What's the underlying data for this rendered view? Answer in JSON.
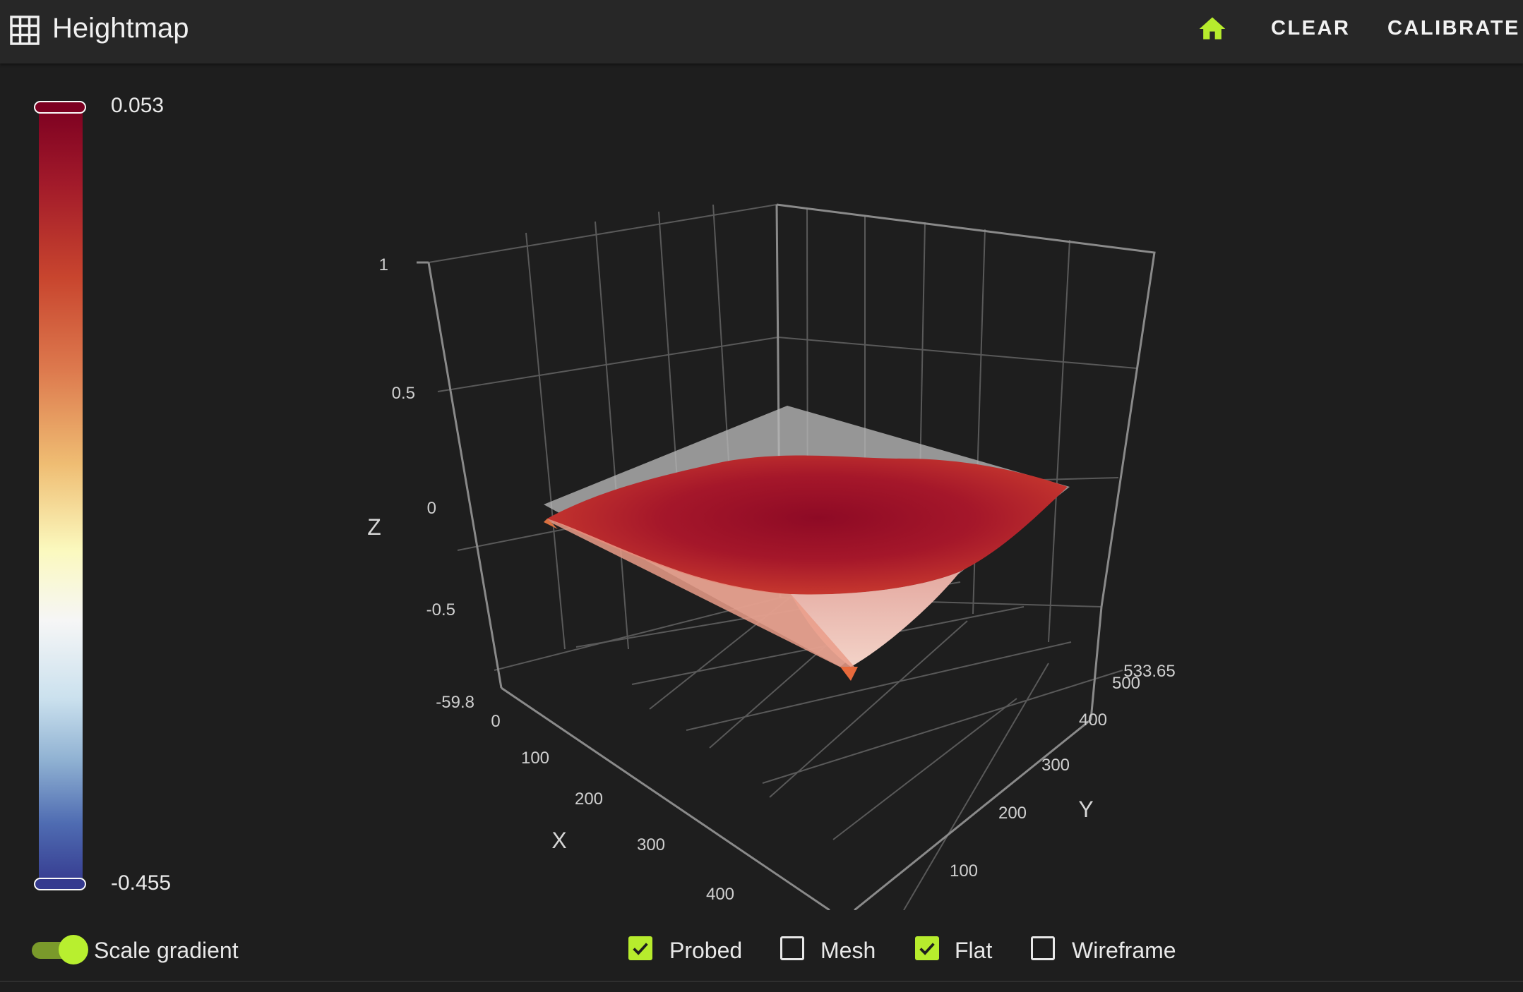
{
  "header": {
    "title": "Heightmap",
    "clear_label": "CLEAR",
    "calibrate_label": "CALIBRATE",
    "accent_color": "#b7ec2d"
  },
  "colorbar": {
    "max_label": "0.053",
    "min_label": "-0.455",
    "colormap": [
      "#7c0021",
      "#c8452e",
      "#efbd73",
      "#fbf9be",
      "#f6f6f6",
      "#8fb1d2",
      "#353a8f"
    ]
  },
  "plot": {
    "z_axis_label": "Z",
    "x_axis_label": "X",
    "y_axis_label": "Y",
    "z_ticks": [
      "1",
      "0.5",
      "0",
      "-0.5",
      "-59.8"
    ],
    "x_ticks": [
      "0",
      "100",
      "200",
      "300",
      "400"
    ],
    "y_ticks": [
      "100",
      "200",
      "300",
      "400",
      "500",
      "533.65"
    ]
  },
  "footer": {
    "scale_gradient_label": "Scale gradient",
    "scale_gradient_on": true,
    "checkboxes": [
      {
        "label": "Probed",
        "checked": true
      },
      {
        "label": "Mesh",
        "checked": false
      },
      {
        "label": "Flat",
        "checked": true
      },
      {
        "label": "Wireframe",
        "checked": false
      }
    ]
  }
}
